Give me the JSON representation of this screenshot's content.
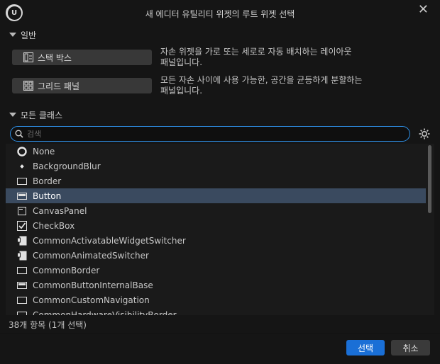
{
  "window": {
    "title": "새 에디터 유틸리티 위젯의 루트 위젯 선택",
    "close_glyph": "✕"
  },
  "sections": {
    "common": {
      "label": "일반"
    },
    "all_classes": {
      "label": "모든 클래스"
    }
  },
  "layouts": [
    {
      "label": "스택 박스",
      "description": "자손 위젯을 가로 또는 세로로 자동 배치하는 레이아웃 패널입니다.",
      "desc_line1": "자손 위젯을 가로 또는 세로로 자동 배치하는 레이아웃",
      "desc_line2": "패널입니다.",
      "icon": "stack-box-icon"
    },
    {
      "label": "그리드 패널",
      "description": "모든 자손 사이에 사용 가능한, 공간을 균등하게 분할하는 패널입니다.",
      "desc_line1": "모든 자손 사이에 사용 가능한, 공간을 균등하게 분할하는",
      "desc_line2": "패널입니다.",
      "icon": "grid-panel-icon"
    }
  ],
  "search": {
    "placeholder": "검색",
    "value": ""
  },
  "classes": [
    {
      "name": "None",
      "icon": "none-circle-icon",
      "selected": false
    },
    {
      "name": "BackgroundBlur",
      "icon": "diamond-icon",
      "selected": false
    },
    {
      "name": "Border",
      "icon": "border-icon",
      "selected": false
    },
    {
      "name": "Button",
      "icon": "button-icon",
      "selected": true
    },
    {
      "name": "CanvasPanel",
      "icon": "canvas-panel-icon",
      "selected": false
    },
    {
      "name": "CheckBox",
      "icon": "checkbox-icon",
      "selected": false
    },
    {
      "name": "CommonActivatableWidgetSwitcher",
      "icon": "switcher-icon",
      "selected": false
    },
    {
      "name": "CommonAnimatedSwitcher",
      "icon": "switcher-icon",
      "selected": false
    },
    {
      "name": "CommonBorder",
      "icon": "border-icon",
      "selected": false
    },
    {
      "name": "CommonButtonInternalBase",
      "icon": "button-icon",
      "selected": false
    },
    {
      "name": "CommonCustomNavigation",
      "icon": "border-icon",
      "selected": false
    },
    {
      "name": "CommonHardwareVisibilityBorder",
      "icon": "border-icon",
      "selected": false
    }
  ],
  "status": {
    "text": "38개 항목 (1개 선택)"
  },
  "footer": {
    "select_label": "선택",
    "cancel_label": "취소"
  },
  "colors": {
    "accent": "#1a6fd6",
    "selection": "#3a4a5f",
    "focus_ring": "#2e8fe6"
  }
}
